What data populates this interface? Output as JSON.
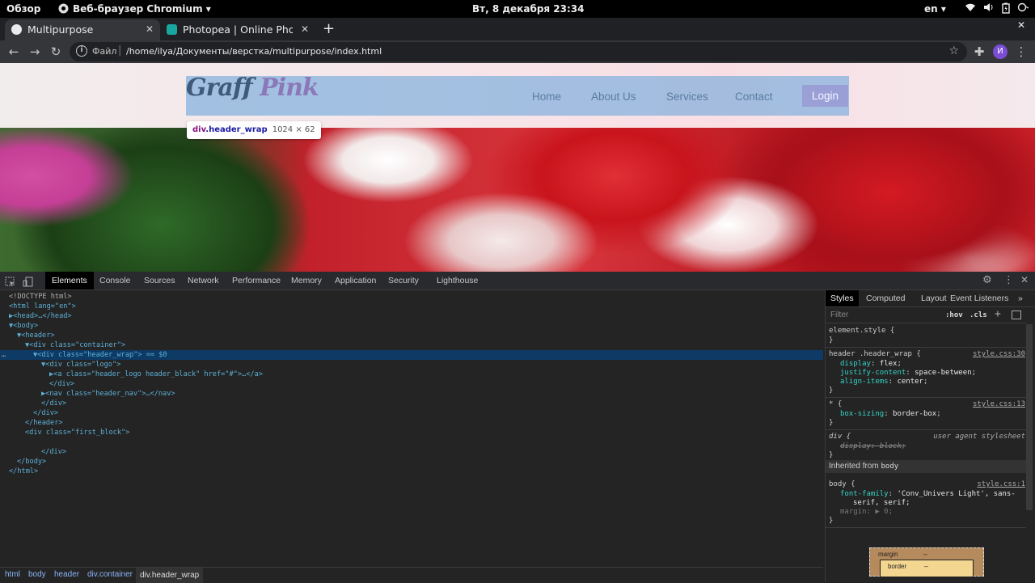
{
  "topbar": {
    "overview": "Обзор",
    "app_name": "Веб-браузер Chromium",
    "app_arrow": "▾",
    "clock": "Вт, 8 декабря  23:34",
    "lang": "en",
    "lang_arrow": "▾"
  },
  "tabs": [
    {
      "label": "Multipurpose",
      "close": "✕"
    },
    {
      "label": "Photopea | Online Photo E",
      "close": "✕"
    }
  ],
  "new_tab": "+",
  "toolbar": {
    "back": "←",
    "forward": "→",
    "reload": "↻",
    "scheme_label": "Файл",
    "separator": "|",
    "url": "/home/ilya/Документы/верстка/multipurpose/index.html",
    "star": "☆",
    "avatar": "И",
    "menu": "⋮",
    "extensions": "✚"
  },
  "site": {
    "logo_part1": "Graff",
    "logo_part2": "Pink",
    "nav": [
      "Home",
      "About Us",
      "Services",
      "Contact"
    ],
    "login": "Login"
  },
  "inspect_tooltip": {
    "tag": "div",
    "cls": ".header_wrap",
    "dims": "1024 × 62"
  },
  "devtools": {
    "tabs": [
      "Elements",
      "Console",
      "Sources",
      "Network",
      "Performance",
      "Memory",
      "Application",
      "Security",
      "Lighthouse"
    ],
    "active_tab": "Elements",
    "dom": [
      {
        "text": "<!DOCTYPE html>"
      },
      {
        "text": "<html lang=\"en\">"
      },
      {
        "text": "▶<head>…</head>"
      },
      {
        "text": "▼<body>"
      },
      {
        "text": "▼<header>"
      },
      {
        "text": "▼<div class=\"container\">"
      },
      {
        "text": "▼<div class=\"header_wrap\"> == $0"
      },
      {
        "text": "▼<div class=\"logo\">"
      },
      {
        "text": "▶<a class=\"header_logo header_black\" href=\"#\">…</a>"
      },
      {
        "text": "</div>"
      },
      {
        "text": "▶<nav class=\"header_nav\">…</nav>"
      },
      {
        "text": "</div>"
      },
      {
        "text": "</div>"
      },
      {
        "text": "</header>"
      },
      {
        "text": "<div class=\"first_block\">"
      },
      {
        "text": ""
      },
      {
        "text": "</div>"
      },
      {
        "text": "</body>"
      },
      {
        "text": "</html>"
      }
    ],
    "ellipsis": "…",
    "breadcrumbs": [
      "html",
      "body",
      "header",
      "div.container",
      "div.header_wrap"
    ],
    "styles_tabs": [
      "Styles",
      "Computed",
      "Layout",
      "Event Listeners",
      "»"
    ],
    "filter_placeholder": "Filter",
    "hov": ":hov",
    "cls": ".cls",
    "plus": "+",
    "element_style": "element.style {",
    "close_brace": "}",
    "rule1_selector": "header .header_wrap {",
    "rule1_link": "style.css:30",
    "rule1_props": [
      [
        "display",
        "flex"
      ],
      [
        "justify-content",
        "space-between"
      ],
      [
        "align-items",
        "center"
      ]
    ],
    "rule2_selector": "* {",
    "rule2_link": "style.css:13",
    "rule2_props": [
      [
        "box-sizing",
        "border-box"
      ]
    ],
    "rule3_selector": "div {",
    "rule3_source": "user agent stylesheet",
    "rule3_props": [
      [
        "display",
        "block"
      ]
    ],
    "inherited_label": "Inherited from",
    "inherited_from": "body",
    "rule4_selector": "body {",
    "rule4_link": "style.css:1",
    "rule4_font_prop": "font-family",
    "rule4_font_val1": "'Conv_Univers Light', sans-",
    "rule4_font_val2": "serif, serif;",
    "rule4_margin": "margin: ▶ 0;",
    "boxmodel_margin": "margin",
    "boxmodel_border": "border",
    "boxmodel_dash": "–"
  }
}
